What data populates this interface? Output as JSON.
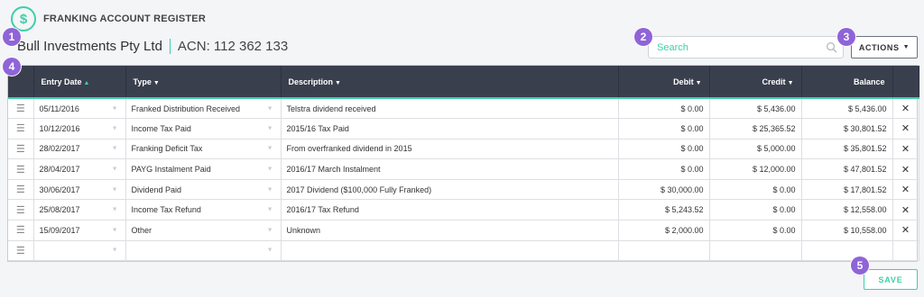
{
  "app": {
    "title": "FRANKING ACCOUNT REGISTER",
    "logo_symbol": "$",
    "accent_color": "#3ecfa8",
    "header_color": "#3a3f4e",
    "badge_color": "#8f64d8"
  },
  "company": {
    "name": "Bull Investments Pty Ltd",
    "acn": "ACN: 112 362 133"
  },
  "search": {
    "placeholder": "Search",
    "value": ""
  },
  "toolbar": {
    "actions_label": "ACTIONS",
    "save_label": "SAVE"
  },
  "badges": [
    "1",
    "2",
    "3",
    "4",
    "5"
  ],
  "columns": {
    "entry_date": "Entry Date",
    "type": "Type",
    "description": "Description",
    "debit": "Debit",
    "credit": "Credit",
    "balance": "Balance"
  },
  "rows": [
    {
      "date": "05/11/2016",
      "type": "Franked Distribution Received",
      "description": "Telstra dividend received",
      "debit": "$ 0.00",
      "credit": "$ 5,436.00",
      "balance": "$ 5,436.00"
    },
    {
      "date": "10/12/2016",
      "type": "Income Tax Paid",
      "description": "2015/16 Tax Paid",
      "debit": "$ 0.00",
      "credit": "$ 25,365.52",
      "balance": "$ 30,801.52"
    },
    {
      "date": "28/02/2017",
      "type": "Franking Deficit Tax",
      "description": "From overfranked dividend in 2015",
      "debit": "$ 0.00",
      "credit": "$ 5,000.00",
      "balance": "$ 35,801.52"
    },
    {
      "date": "28/04/2017",
      "type": "PAYG Instalment Paid",
      "description": "2016/17 March Instalment",
      "debit": "$ 0.00",
      "credit": "$ 12,000.00",
      "balance": "$ 47,801.52"
    },
    {
      "date": "30/06/2017",
      "type": "Dividend Paid",
      "description": "2017 Dividend ($100,000 Fully Franked)",
      "debit": "$ 30,000.00",
      "credit": "$ 0.00",
      "balance": "$ 17,801.52"
    },
    {
      "date": "25/08/2017",
      "type": "Income Tax Refund",
      "description": "2016/17 Tax Refund",
      "debit": "$ 5,243.52",
      "credit": "$ 0.00",
      "balance": "$ 12,558.00"
    },
    {
      "date": "15/09/2017",
      "type": "Other",
      "description": "Unknown",
      "debit": "$ 2,000.00",
      "credit": "$ 0.00",
      "balance": "$ 10,558.00"
    },
    {
      "date": "",
      "type": "",
      "description": "",
      "debit": "",
      "credit": "",
      "balance": ""
    }
  ]
}
